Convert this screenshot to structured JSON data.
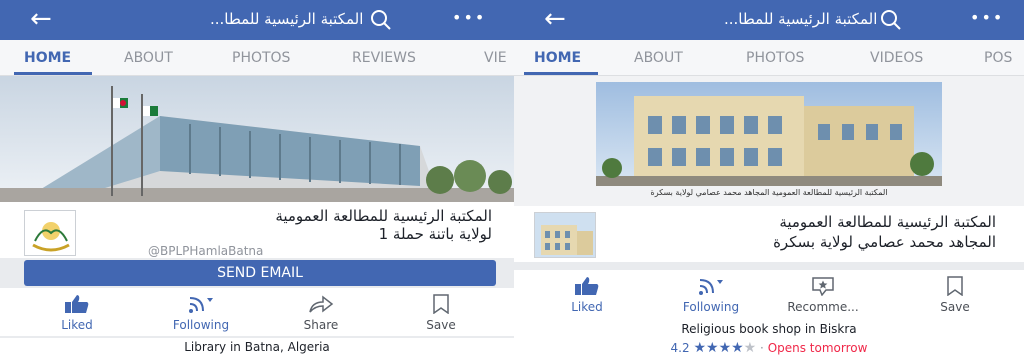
{
  "left_screen": {
    "title": "المكتبة الرئيسية للمطا...",
    "tabs": [
      "HOME",
      "ABOUT",
      "PHOTOS",
      "REVIEWS",
      "VIE"
    ],
    "page_name_line1": "المكتبة الرئيسية للمطالعة العمومية",
    "page_name_line2": "لولاية باتنة حملة 1",
    "handle": "@BPLPHamlaBatna",
    "send_email": "SEND EMAIL",
    "actions": {
      "liked": "Liked",
      "following": "Following",
      "share": "Share",
      "save": "Save"
    },
    "category": "Library in Batna, Algeria"
  },
  "right_screen": {
    "title": "المكتبة الرئيسية للمطا...",
    "tabs": [
      "HOME",
      "ABOUT",
      "PHOTOS",
      "VIDEOS",
      "POS"
    ],
    "cover_caption": "المكتبة الرئيسية للمطالعة العمومية المجاهد محمد عصامي لولاية بسكرة",
    "page_name_line1": "المكتبة الرئيسية للمطالعة العمومية",
    "page_name_line2": "المجاهد محمد عصامي لولاية بسكرة",
    "actions": {
      "liked": "Liked",
      "following": "Following",
      "recommend": "Recomme...",
      "save": "Save"
    },
    "category": "Religious book shop in Biskra",
    "rating_value": "4.2",
    "stars_on": "★★★★",
    "stars_off": "★",
    "rating_sep": " · ",
    "opens": "Opens tomorrow"
  },
  "icons": [
    "back-arrow-icon",
    "search-icon",
    "more-icon",
    "thumbs-up-icon",
    "rss-icon",
    "share-icon",
    "bookmark-icon",
    "recommend-icon"
  ],
  "colors": {
    "brand": "#4267b2",
    "accent_red": "#f02849",
    "muted": "#90949c"
  }
}
